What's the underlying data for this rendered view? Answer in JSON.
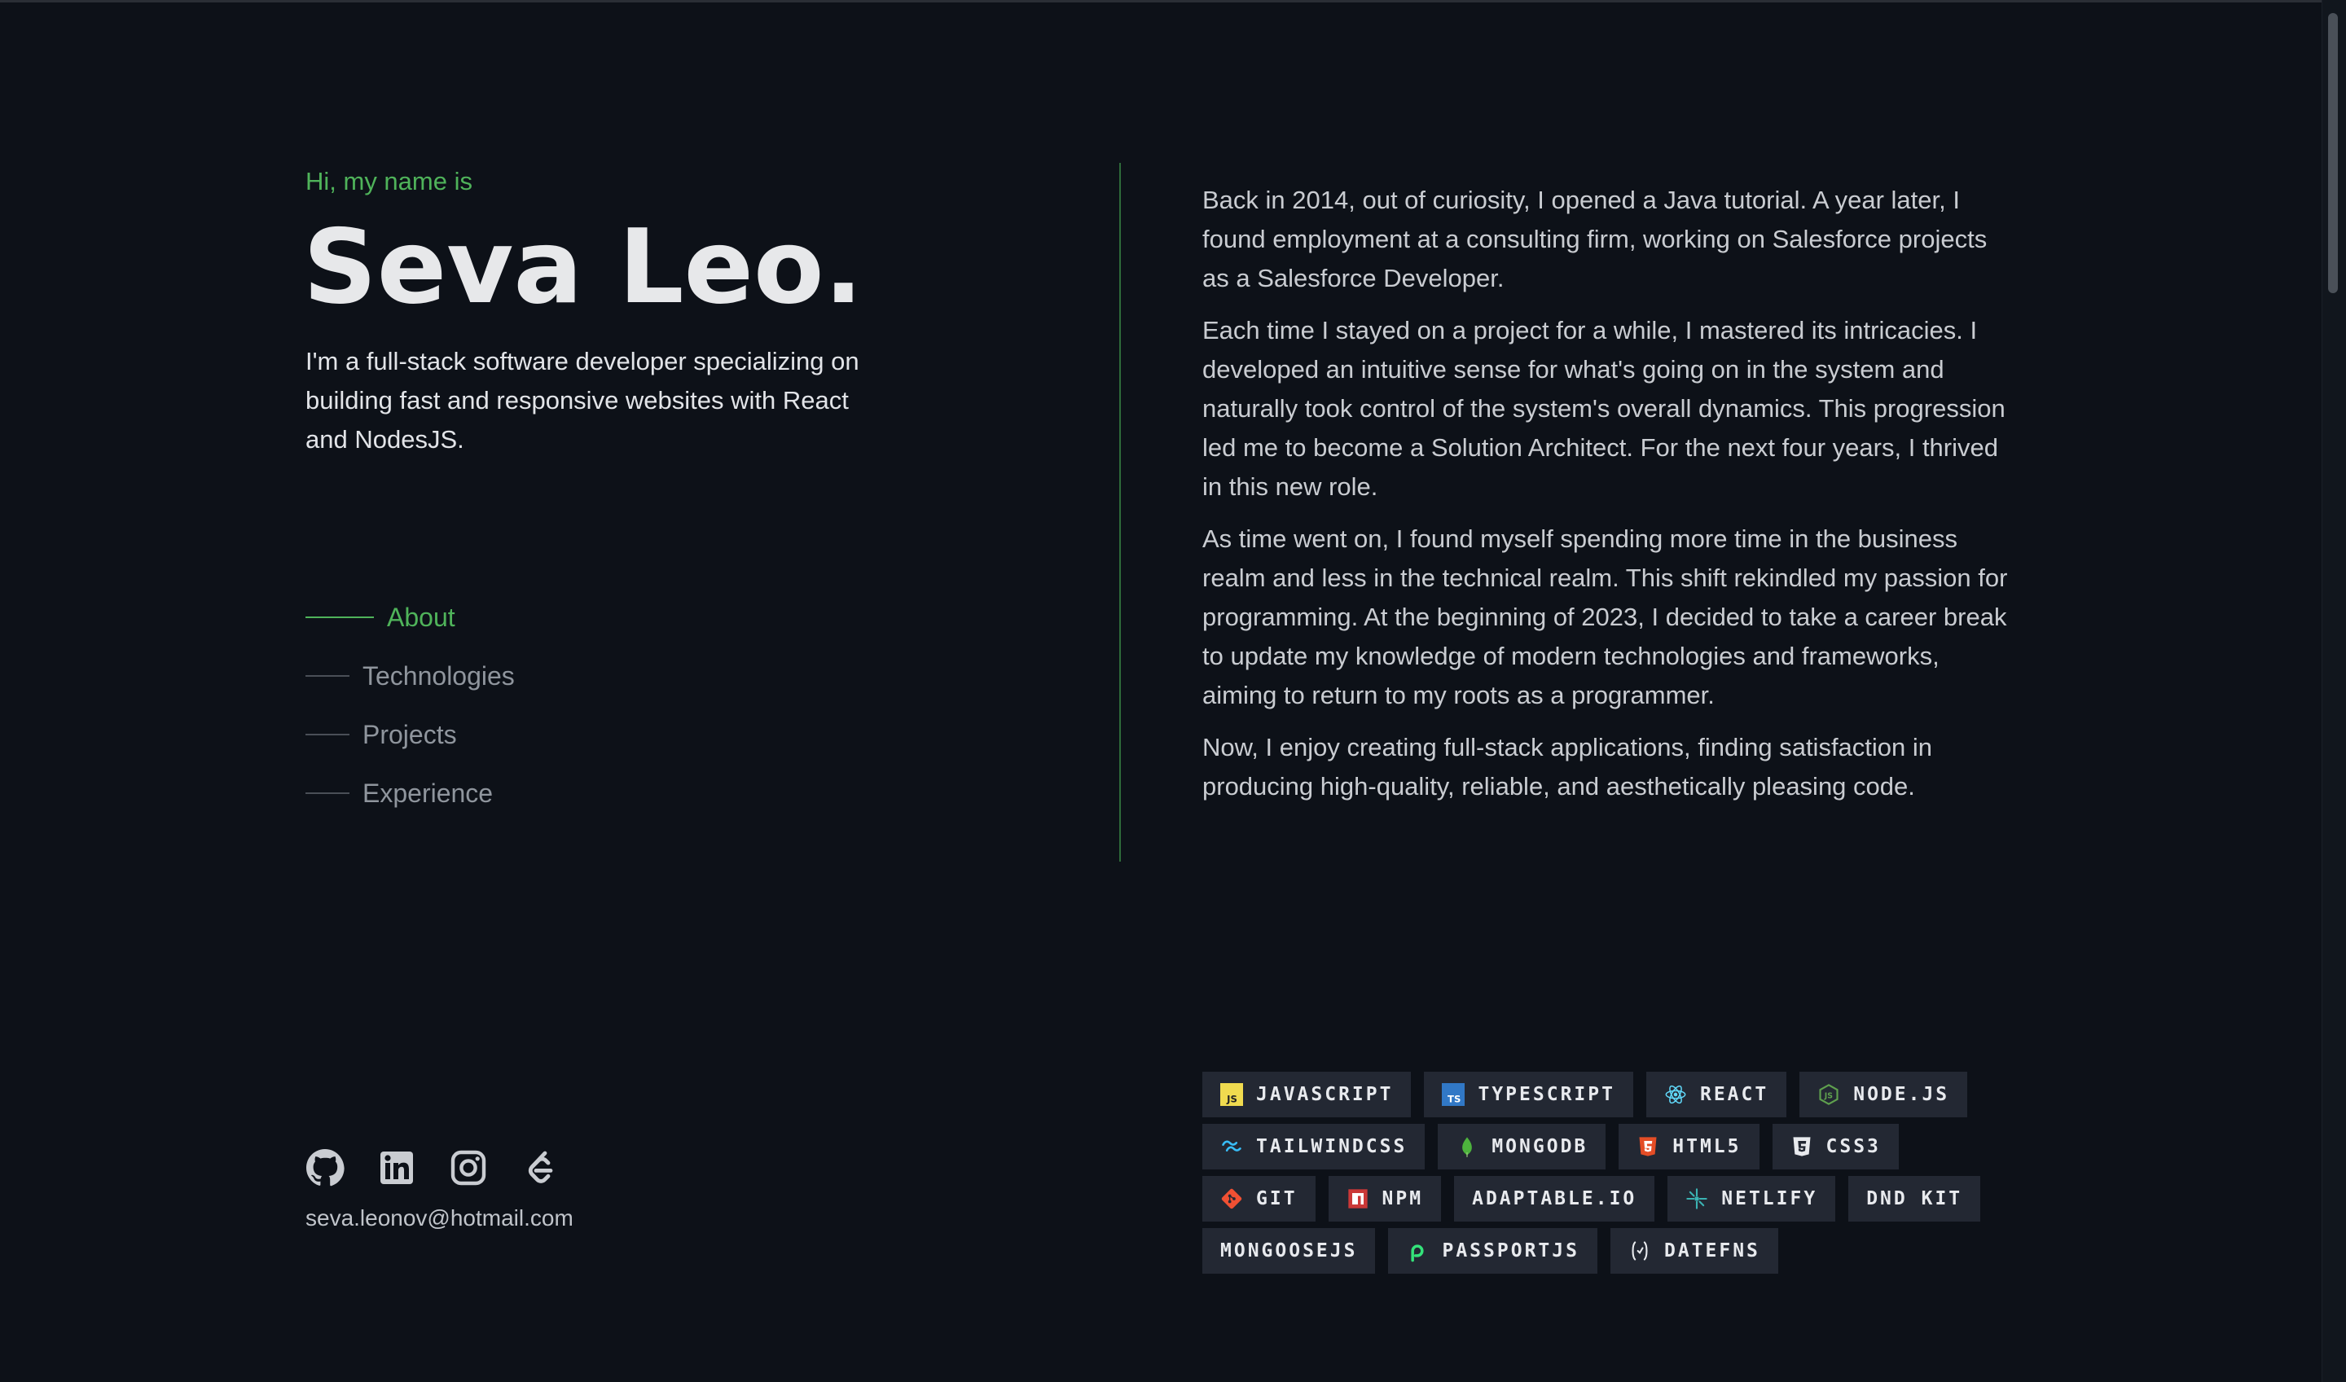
{
  "hero": {
    "greeting": "Hi, my name is",
    "name": "Seva Leo.",
    "tagline": "I'm a full-stack software developer specializing on building fast and responsive websites with React and NodesJS."
  },
  "nav": {
    "items": [
      {
        "label": "About",
        "active": true
      },
      {
        "label": "Technologies",
        "active": false
      },
      {
        "label": "Projects",
        "active": false
      },
      {
        "label": "Experience",
        "active": false
      }
    ]
  },
  "about": {
    "paragraphs": [
      "Back in 2014, out of curiosity, I opened a Java tutorial. A year later, I found employment at a consulting firm, working on Salesforce projects as a Salesforce Developer.",
      "Each time I stayed on a project for a while, I mastered its intricacies. I developed an intuitive sense for what's going on in the system and naturally took control of the system's overall dynamics. This progression led me to become a Solution Architect. For the next four years, I thrived in this new role.",
      "As time went on, I found myself spending more time in the business realm and less in the technical realm. This shift rekindled my passion for programming. At the beginning of 2023, I decided to take a career break to update my knowledge of modern technologies and frameworks, aiming to return to my roots as a programmer.",
      "Now, I enjoy creating full-stack applications, finding satisfaction in producing high-quality, reliable, and aesthetically pleasing code."
    ]
  },
  "social": {
    "icons": [
      "github-icon",
      "linkedin-icon",
      "instagram-icon",
      "leetcode-icon"
    ],
    "email": "seva.leonov@hotmail.com"
  },
  "technologies": {
    "rows": [
      [
        {
          "label": "JAVASCRIPT",
          "icon": "javascript-icon"
        },
        {
          "label": "TYPESCRIPT",
          "icon": "typescript-icon"
        },
        {
          "label": "REACT",
          "icon": "react-icon"
        },
        {
          "label": "NODE.JS",
          "icon": "nodejs-icon"
        }
      ],
      [
        {
          "label": "TAILWINDCSS",
          "icon": "tailwind-icon"
        },
        {
          "label": "MONGODB",
          "icon": "mongodb-icon"
        },
        {
          "label": "HTML5",
          "icon": "html5-icon"
        },
        {
          "label": "CSS3",
          "icon": "css3-icon"
        }
      ],
      [
        {
          "label": "GIT",
          "icon": "git-icon"
        },
        {
          "label": "NPM",
          "icon": "npm-icon"
        },
        {
          "label": "ADAPTABLE.IO",
          "icon": ""
        },
        {
          "label": "NETLIFY",
          "icon": "netlify-icon"
        },
        {
          "label": "DND KIT",
          "icon": ""
        }
      ],
      [
        {
          "label": "MONGOOSEJS",
          "icon": ""
        },
        {
          "label": "PASSPORTJS",
          "icon": "passport-icon"
        },
        {
          "label": "DATEFNS",
          "icon": "datefns-icon"
        }
      ]
    ]
  },
  "colors": {
    "background": "#0d1118",
    "accent": "#4fb35a",
    "chip_bg": "#232833"
  }
}
